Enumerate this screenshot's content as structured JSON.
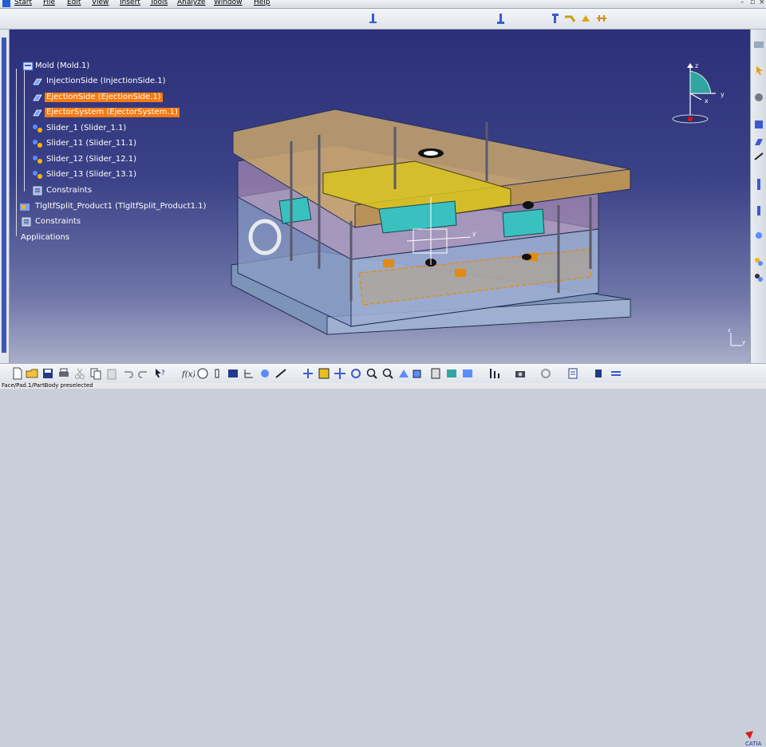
{
  "menu": {
    "items": [
      "Start",
      "File",
      "Edit",
      "View",
      "Insert",
      "Tools",
      "Analyze",
      "Window",
      "Help"
    ]
  },
  "tree": {
    "root": "Mold (Mold.1)",
    "children": [
      {
        "label": "InjectionSide (InjectionSide.1)",
        "selected": false,
        "icon": "part-icon"
      },
      {
        "label": "EjectionSide (EjectionSide.1)",
        "selected": true,
        "icon": "part-icon"
      },
      {
        "label": "EjectorSystem (EjectorSystem.1)",
        "selected": true,
        "icon": "part-icon"
      },
      {
        "label": "Slider_1 (Slider_1.1)",
        "selected": false,
        "icon": "product-icon"
      },
      {
        "label": "Slider_11 (Slider_11.1)",
        "selected": false,
        "icon": "product-icon"
      },
      {
        "label": "Slider_12 (Slider_12.1)",
        "selected": false,
        "icon": "product-icon"
      },
      {
        "label": "Slider_13 (Slider_13.1)",
        "selected": false,
        "icon": "product-icon"
      },
      {
        "label": "Constraints",
        "selected": false,
        "icon": "constraints-icon"
      }
    ],
    "top2": "TlgltfSplit_Product1 (TlgltfSplit_Product1.1)",
    "top3": "Constraints",
    "top4": "Applications"
  },
  "compass": {
    "x": "x",
    "y": "y",
    "z": "z"
  },
  "axis_small": {
    "y": "y",
    "z": "z"
  },
  "status": {
    "text": "Face/Pad.1/PartBody preselected"
  },
  "colors": {
    "selection": "#f57a12",
    "viewport_top": "#2b2f78",
    "viewport_bottom": "#a9aec8"
  }
}
